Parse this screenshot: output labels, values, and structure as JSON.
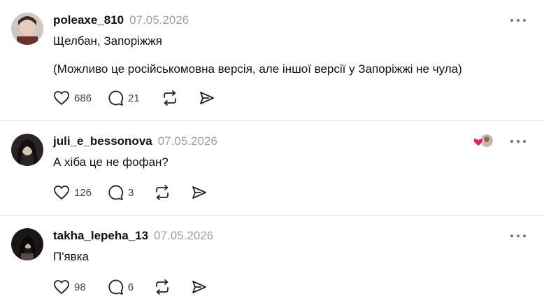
{
  "posts": [
    {
      "username": "poleaxe_810",
      "date": "07.05.2026",
      "lines": [
        "Щелбан, Запоріжжя",
        "(Можливо це російськомовна версія, але іншої версії у Запоріжжі не чула)"
      ],
      "likes": "686",
      "comments": "21"
    },
    {
      "username": "juli_e_bessonova",
      "date": "07.05.2026",
      "lines": [
        "А хіба це не фофан?"
      ],
      "likes": "126",
      "comments": "3"
    },
    {
      "username": "takha_lepeha_13",
      "date": "07.05.2026",
      "lines": [
        "П'явка"
      ],
      "likes": "98",
      "comments": "6"
    }
  ],
  "colors": {
    "date": "#a0a0a0",
    "divider": "#e2e2e2",
    "heart_badge": "#e0245e"
  },
  "icons": [
    "heart-icon",
    "comment-icon",
    "repost-icon",
    "share-icon",
    "more-icon"
  ]
}
